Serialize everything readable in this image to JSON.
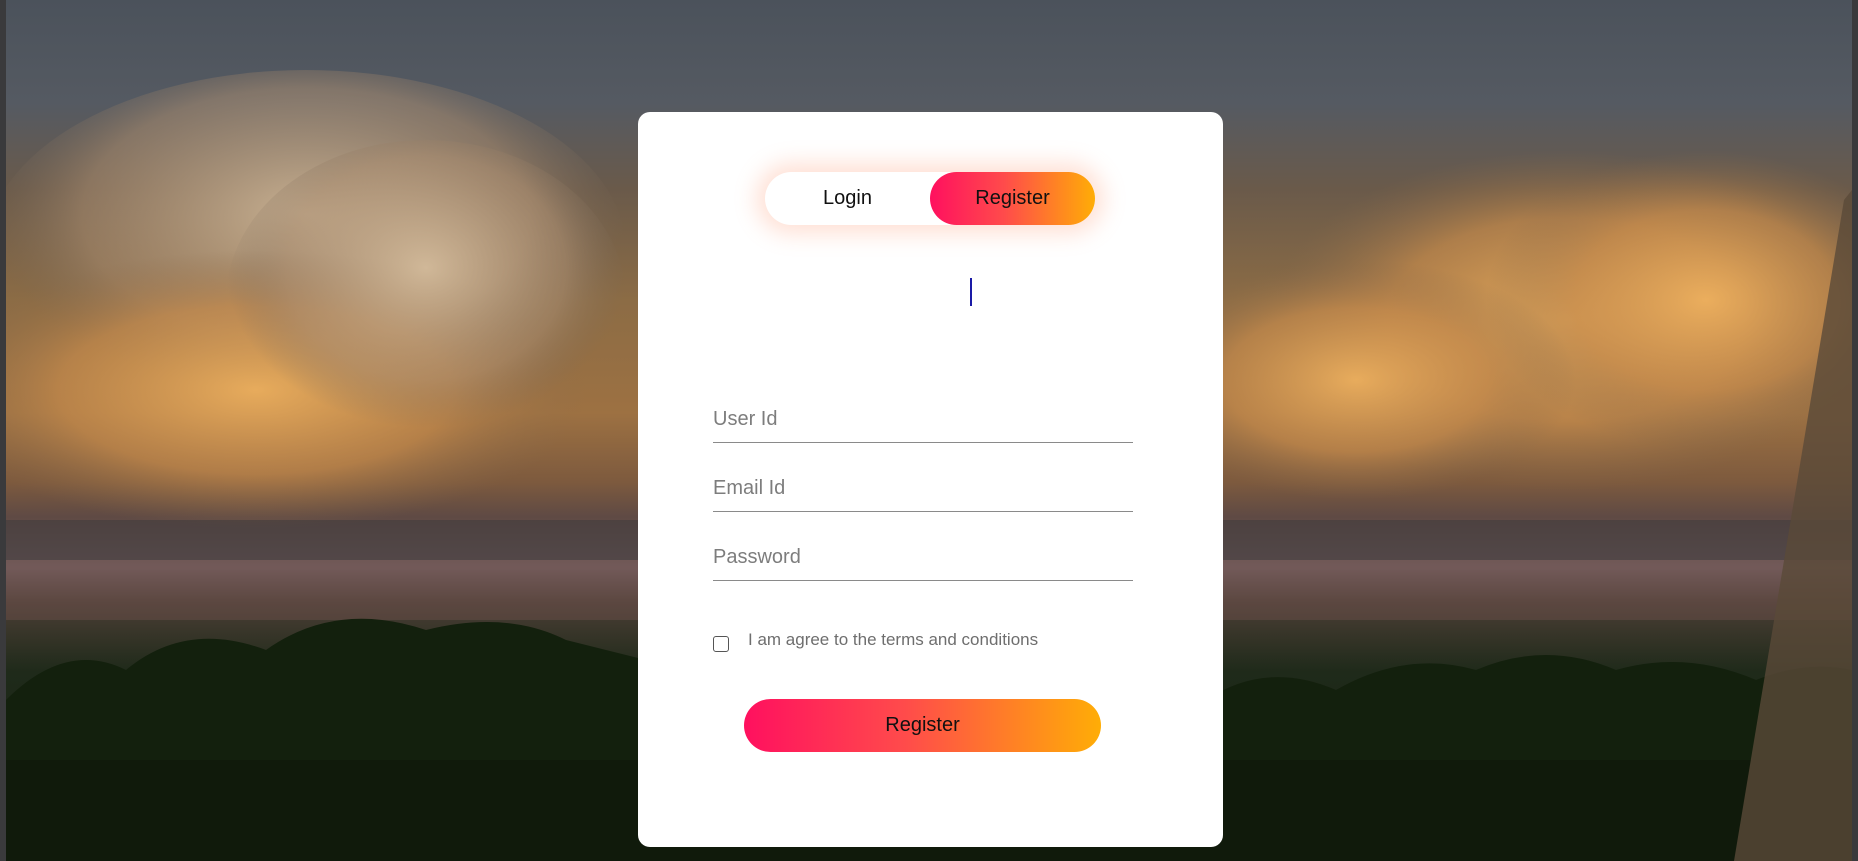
{
  "toggle": {
    "login_label": "Login",
    "register_label": "Register",
    "active": "register"
  },
  "form": {
    "user_id_placeholder": "User Id",
    "email_placeholder": "Email Id",
    "password_placeholder": "Password",
    "terms_label": "I am agree to the terms and conditions",
    "terms_checked": false,
    "submit_label": "Register"
  },
  "colors": {
    "gradient_start": "#ff105f",
    "gradient_end": "#ffad06",
    "card_background": "#ffffff"
  }
}
